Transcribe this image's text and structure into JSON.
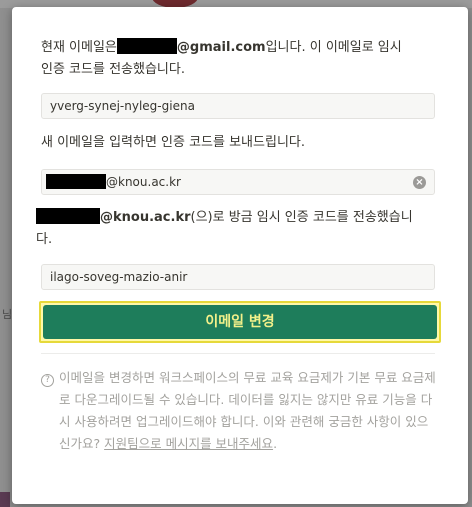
{
  "background": {
    "top_text": "...",
    "bottom_text": "...",
    "left_mark": "님"
  },
  "modal": {
    "intro_prefix": "현재 이메일은",
    "intro_email_domain": "@gmail.com",
    "intro_suffix": "입니다. 이 이메일로 임시",
    "intro_line2": "인증 코드를 전송했습니다.",
    "first_code_value": "yverg-synej-nyleg-giena",
    "new_email_prompt": "새 이메일을 입력하면 인증 코드를 보내드립니다.",
    "new_email_domain": "@knou.ac.kr",
    "sent_domain": "@knou.ac.kr",
    "sent_suffix": "(으)로 방금 임시 인증 코드를 전송했습니",
    "sent_line2": "다.",
    "second_code_value": "ilago-soveg-mazio-anir",
    "change_email_button": "이메일 변경",
    "info_text": "이메일을 변경하면 워크스페이스의 무료 교육 요금제가 기본 무료 요금제로 다운그레이드될 수 있습니다. 데이터를 잃지는 않지만 유료 기능을 다시 사용하려면 업그레이드해야 합니다. 이와 관련해 궁금한 사항이 있으신가요? ",
    "info_link": "지원팀으로 메시지를 보내주세요",
    "info_end": ".",
    "info_icon": "?",
    "clear_icon": "×"
  },
  "colors": {
    "button_bg": "#1e7d5b",
    "button_text": "#f3f08a",
    "highlight_border": "#e6d93a"
  }
}
